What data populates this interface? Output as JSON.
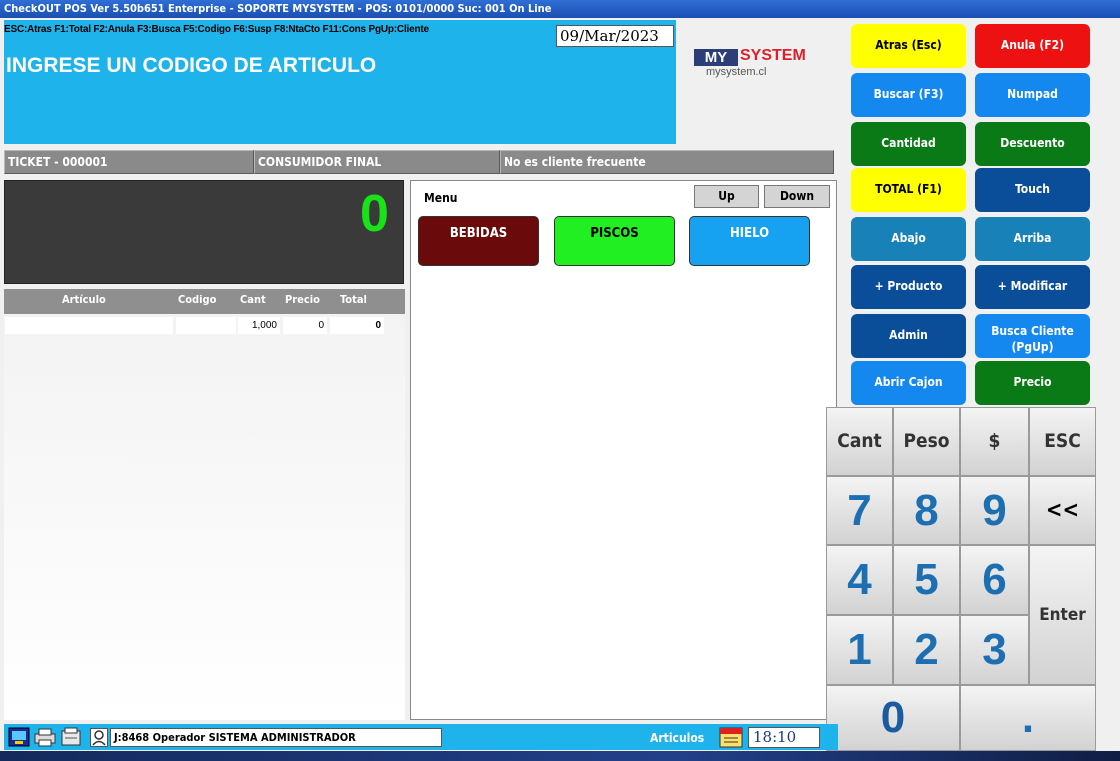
{
  "window": {
    "title": "CheckOUT POS Ver 5.50b651 Enterprise - SOPORTE MYSYSTEM - POS: 0101/0000 Suc: 001  On Line"
  },
  "header": {
    "shortcuts": "ESC:Atras F1:Total F2:Anula F3:Busca F5:Codigo F6:Susp F8:NtaCto F11:Cons PgUp:Cliente",
    "date": "09/Mar/2023",
    "prompt": "INGRESE UN CODIGO DE ARTICULO"
  },
  "logo": {
    "my": "MY",
    "system": "SYSTEM",
    "url": "mysystem.cl"
  },
  "info": {
    "ticket": "TICKET - 000001",
    "customer": "CONSUMIDOR FINAL",
    "frequent": "No es cliente frecuente"
  },
  "total": {
    "value": "0"
  },
  "grid": {
    "headers": [
      "Artículo",
      "Codigo",
      "Cant",
      "Precio",
      "Total"
    ],
    "row": {
      "articulo": "",
      "codigo": "",
      "cant": "1,000",
      "precio": "0",
      "total": "0"
    }
  },
  "menu": {
    "label": "Menu",
    "up": "Up",
    "down": "Down",
    "categories": [
      {
        "label": "BEBIDAS",
        "color": "#6b0a0a",
        "text": "#ffffff"
      },
      {
        "label": "PISCOS",
        "color": "#21ef21",
        "text": "#000000"
      },
      {
        "label": "HIELO",
        "color": "#16a2f0",
        "text": "#ffffff"
      }
    ]
  },
  "functions": [
    {
      "label": "Atras (Esc)",
      "color": "#ffff00",
      "text": "#000000"
    },
    {
      "label": "Anula (F2)",
      "color": "#ee1111",
      "text": "#ffffff"
    },
    {
      "label": "Buscar (F3)",
      "color": "#1488ee",
      "text": "#ffffff"
    },
    {
      "label": "Numpad",
      "color": "#1488ee",
      "text": "#ffffff"
    },
    {
      "label": "Cantidad",
      "color": "#0a7a16",
      "text": "#ffffff"
    },
    {
      "label": "Descuento",
      "color": "#0a7a16",
      "text": "#ffffff"
    },
    {
      "label": "TOTAL (F1)",
      "color": "#ffff00",
      "text": "#000000"
    },
    {
      "label": "Touch",
      "color": "#0a4e9a",
      "text": "#ffffff"
    },
    {
      "label": "Abajo",
      "color": "#1882b8",
      "text": "#ffffff"
    },
    {
      "label": "Arriba",
      "color": "#1882b8",
      "text": "#ffffff"
    },
    {
      "label": "+ Producto",
      "color": "#0a4e9a",
      "text": "#ffffff"
    },
    {
      "label": "+ Modificar",
      "color": "#0a4e9a",
      "text": "#ffffff"
    },
    {
      "label": "Admin",
      "color": "#0a4e9a",
      "text": "#ffffff"
    },
    {
      "label": "Busca Cliente (PgUp)",
      "color": "#1488ee",
      "text": "#ffffff"
    },
    {
      "label": "Abrir Cajon",
      "color": "#1488ee",
      "text": "#ffffff"
    },
    {
      "label": "Precio",
      "color": "#0a7a16",
      "text": "#ffffff"
    }
  ],
  "numpad": {
    "cant": "Cant",
    "peso": "Peso",
    "dollar": "$",
    "esc": "ESC",
    "k7": "7",
    "k8": "8",
    "k9": "9",
    "back": "<<",
    "k4": "4",
    "k5": "5",
    "k6": "6",
    "enter": "Enter",
    "k1": "1",
    "k2": "2",
    "k3": "3",
    "k0": "0",
    "dot": "."
  },
  "status": {
    "operator": "J:8468 Operador  SISTEMA ADMINISTRADOR",
    "articulos": "Articulos",
    "time": "18:10"
  }
}
